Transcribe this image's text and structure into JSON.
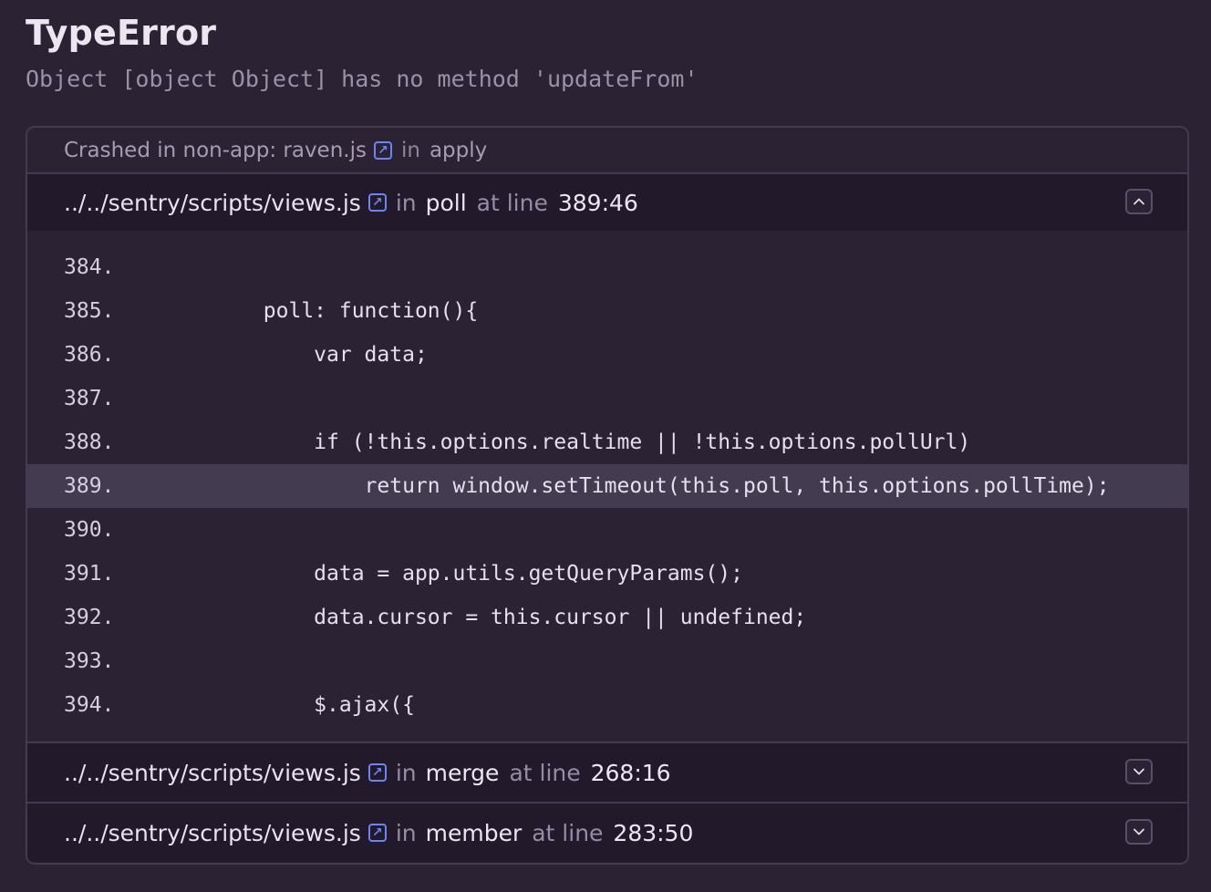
{
  "error": {
    "type": "TypeError",
    "message": "Object [object Object] has no method 'updateFrom'"
  },
  "crash": {
    "prefix": "Crashed in non-app: raven.js",
    "in_label": "in",
    "function": "apply"
  },
  "frames": [
    {
      "file": "../../sentry/scripts/views.js",
      "in_label": "in",
      "function": "poll",
      "at_line_label": "at line",
      "location": "389:46",
      "expanded": true,
      "toggle_icon": "chevron-up-icon"
    },
    {
      "file": "../../sentry/scripts/views.js",
      "in_label": "in",
      "function": "merge",
      "at_line_label": "at line",
      "location": "268:16",
      "expanded": false,
      "toggle_icon": "chevron-down-icon"
    },
    {
      "file": "../../sentry/scripts/views.js",
      "in_label": "in",
      "function": "member",
      "at_line_label": "at line",
      "location": "283:50",
      "expanded": false,
      "toggle_icon": "chevron-down-icon"
    }
  ],
  "code": {
    "active_line": "389.",
    "lines": [
      {
        "num": "384.",
        "text": ""
      },
      {
        "num": "385.",
        "text": "        poll: function(){"
      },
      {
        "num": "386.",
        "text": "            var data;"
      },
      {
        "num": "387.",
        "text": ""
      },
      {
        "num": "388.",
        "text": "            if (!this.options.realtime || !this.options.pollUrl)"
      },
      {
        "num": "389.",
        "text": "                return window.setTimeout(this.poll, this.options.pollTime);"
      },
      {
        "num": "390.",
        "text": ""
      },
      {
        "num": "391.",
        "text": "            data = app.utils.getQueryParams();"
      },
      {
        "num": "392.",
        "text": "            data.cursor = this.cursor || undefined;"
      },
      {
        "num": "393.",
        "text": ""
      },
      {
        "num": "394.",
        "text": "            $.ajax({"
      }
    ]
  },
  "colors": {
    "background": "#2b2233",
    "header_background": "#221a2a",
    "border": "#443a52",
    "highlight": "#433b50",
    "link_icon": "#6b86f1"
  }
}
